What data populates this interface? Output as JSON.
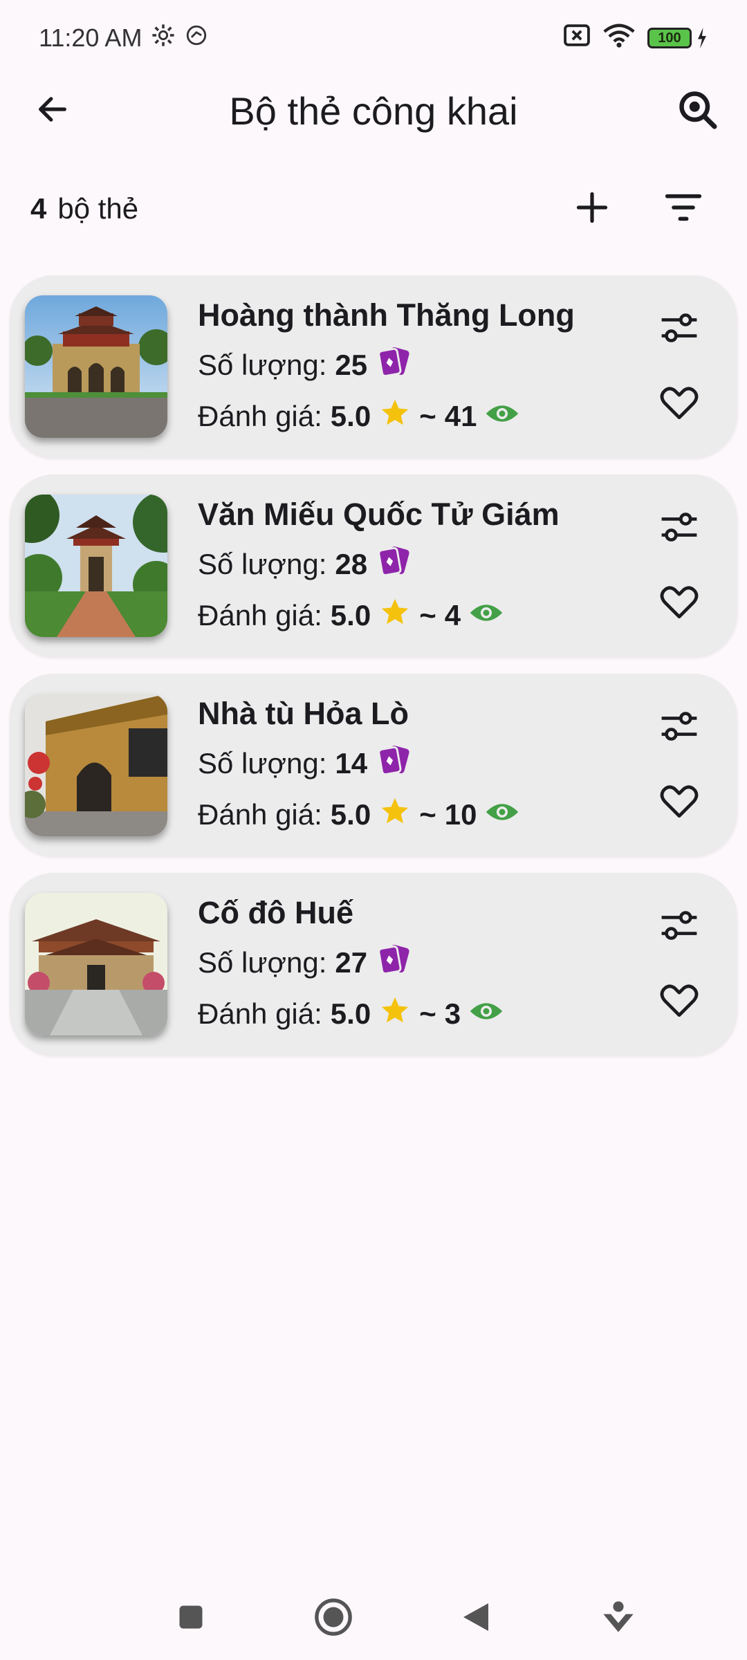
{
  "status_bar": {
    "time": "11:20 AM",
    "battery": "100"
  },
  "app_bar": {
    "title": "Bộ thẻ công khai",
    "back_icon": "arrow-back-icon",
    "search_icon": "search-icon"
  },
  "summary": {
    "count": "4",
    "label": "bộ thẻ",
    "add_icon": "plus-icon",
    "filter_icon": "filter-icon"
  },
  "labels": {
    "quantity": "Số lượng:",
    "rating": "Đánh giá:",
    "tilde": "~"
  },
  "decks": [
    {
      "title": "Hoàng thành Thăng Long",
      "quantity": "25",
      "rating": "5.0",
      "views": "41"
    },
    {
      "title": "Văn Miếu Quốc Tử Giám",
      "quantity": "28",
      "rating": "5.0",
      "views": "4"
    },
    {
      "title": "Nhà tù Hỏa Lò",
      "quantity": "14",
      "rating": "5.0",
      "views": "10"
    },
    {
      "title": "Cố đô Huế",
      "quantity": "27",
      "rating": "5.0",
      "views": "3"
    }
  ],
  "colors": {
    "card_icon": "#8e24aa",
    "star": "#f4c20d",
    "eye": "#43a047",
    "card_bg": "#ececec"
  }
}
